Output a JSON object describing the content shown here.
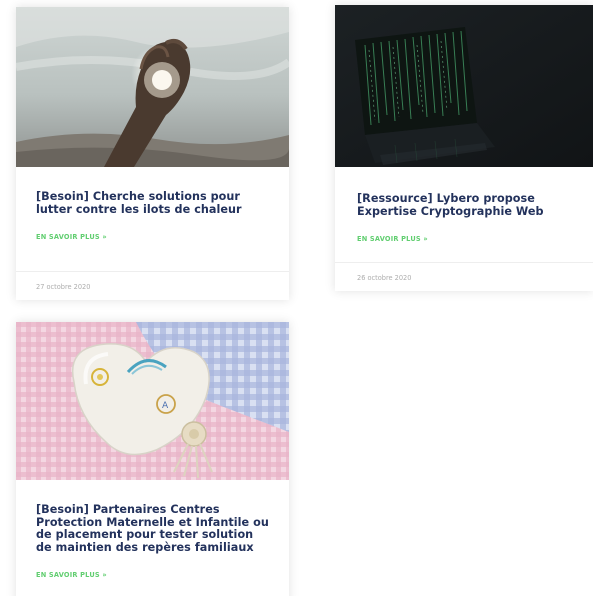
{
  "cards": [
    {
      "title": "[Besoin] Cherche solutions pour lutter contre les ilots de chaleur",
      "read_more": "EN SAVOIR PLUS »",
      "date": "27 octobre 2020"
    },
    {
      "title": "[Ressource] Lybero propose Expertise Cryptographie Web",
      "read_more": "EN SAVOIR PLUS »",
      "date": "26 octobre 2020"
    },
    {
      "title": "[Besoin] Partenaires Centres Protection Maternelle et Infantile ou de placement pour tester solution de maintien des repères familiaux",
      "read_more": "EN SAVOIR PLUS »"
    }
  ],
  "colors": {
    "title": "#23325c",
    "read_more": "#61ce70",
    "date": "#adadad"
  }
}
